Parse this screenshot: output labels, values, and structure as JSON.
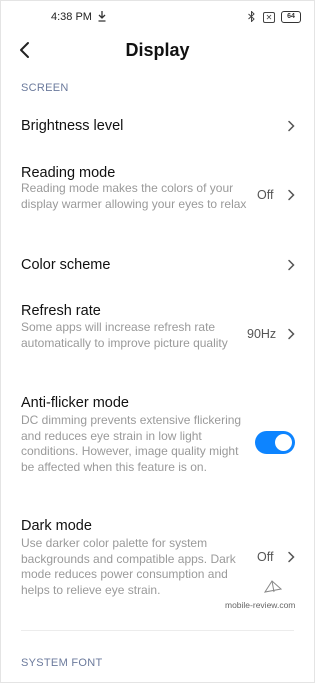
{
  "status_bar": {
    "time": "4:38 PM",
    "download_icon": "download-icon",
    "bluetooth_icon": "bluetooth-icon",
    "sim_icon": "no-sim-icon",
    "battery": "64"
  },
  "header": {
    "back_icon": "back-arrow-icon",
    "title": "Display"
  },
  "sections": {
    "screen": "SCREEN",
    "system_font": "SYSTEM FONT"
  },
  "items": [
    {
      "title": "Brightness level",
      "desc": "",
      "value": ""
    },
    {
      "title": "Reading mode",
      "desc": "Reading mode makes the colors of your display warmer allowing your eyes to relax",
      "value": "Off"
    },
    {
      "title": "Color scheme",
      "desc": "",
      "value": ""
    },
    {
      "title": "Refresh rate",
      "desc": "Some apps will increase refresh rate automatically to improve picture quality",
      "value": "90Hz"
    },
    {
      "title": "Anti-flicker mode",
      "desc": "DC dimming prevents extensive flickering and reduces eye strain in low light conditions. However, image quality might be affected when this feature is on.",
      "toggle_on": true
    },
    {
      "title": "Dark mode",
      "desc": "Use darker color palette for system backgrounds and compatible apps. Dark mode reduces power consumption and helps to relieve eye strain.",
      "value": "Off"
    }
  ],
  "watermark": "mobile-review.com",
  "colors": {
    "accent": "#0d84ff",
    "section_label": "#6b7a9c",
    "description": "#9a9a9a"
  }
}
